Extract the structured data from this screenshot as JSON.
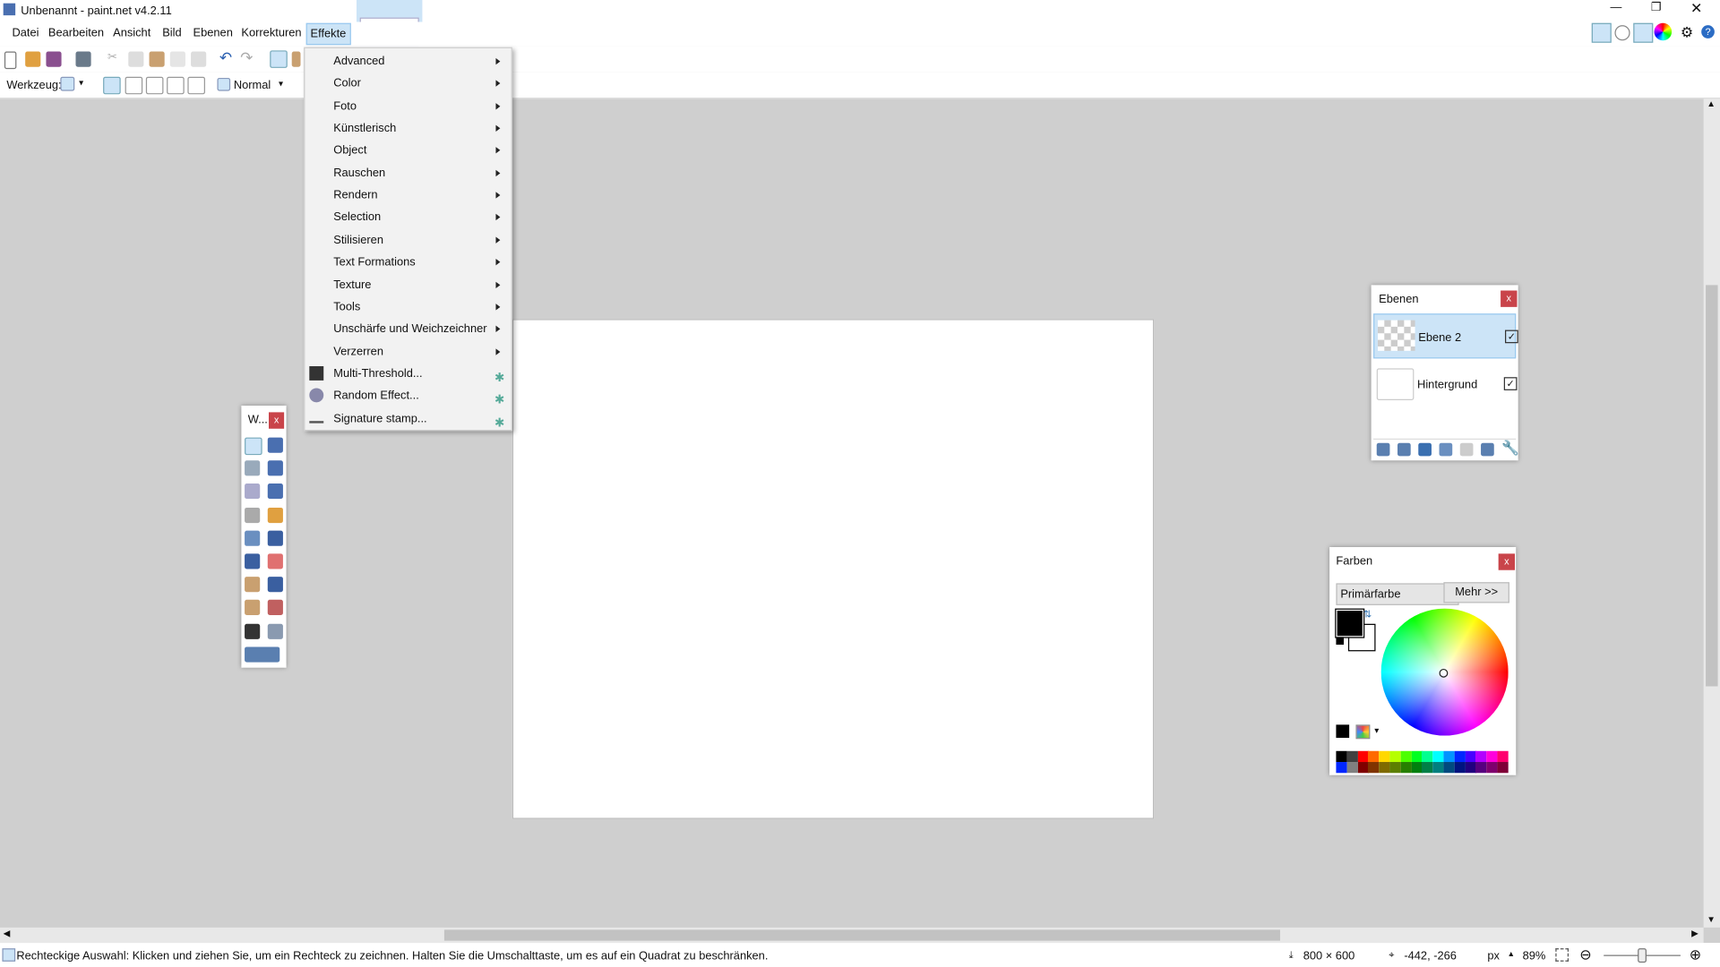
{
  "window": {
    "title": "Unbenannt - paint.net v4.2.11"
  },
  "menubar": [
    "Datei",
    "Bearbeiten",
    "Ansicht",
    "Bild",
    "Ebenen",
    "Korrekturen",
    "Effekte"
  ],
  "toolbar": {
    "tool_label": "Werkzeug:",
    "blend_mode": "Normal"
  },
  "effects_menu": [
    {
      "label": "Advanced",
      "submenu": true
    },
    {
      "label": "Color",
      "submenu": true
    },
    {
      "label": "Foto",
      "submenu": true
    },
    {
      "label": "Künstlerisch",
      "submenu": true
    },
    {
      "label": "Object",
      "submenu": true
    },
    {
      "label": "Rauschen",
      "submenu": true
    },
    {
      "label": "Rendern",
      "submenu": true
    },
    {
      "label": "Selection",
      "submenu": true
    },
    {
      "label": "Stilisieren",
      "submenu": true
    },
    {
      "label": "Text Formations",
      "submenu": true
    },
    {
      "label": "Texture",
      "submenu": true
    },
    {
      "label": "Tools",
      "submenu": true
    },
    {
      "label": "Unschärfe und Weichzeichner",
      "submenu": true
    },
    {
      "label": "Verzerren",
      "submenu": true
    },
    {
      "label": "Multi-Threshold...",
      "plugin": true
    },
    {
      "label": "Random Effect...",
      "plugin": true
    },
    {
      "label": "Signature stamp...",
      "plugin": true
    }
  ],
  "tools_panel": {
    "title": "W...",
    "close": "x"
  },
  "layers_panel": {
    "title": "Ebenen",
    "close": "x",
    "layers": [
      {
        "name": "Ebene 2",
        "visible": true,
        "selected": true
      },
      {
        "name": "Hintergrund",
        "visible": true,
        "selected": false
      }
    ]
  },
  "colors_panel": {
    "title": "Farben",
    "close": "x",
    "mode": "Primärfarbe",
    "more": "Mehr >>",
    "primary": "#000000",
    "secondary": "#ffffff",
    "palette_top": [
      "#000000",
      "#404040",
      "#ff0000",
      "#ff6a00",
      "#ffd800",
      "#b6ff00",
      "#4cff00",
      "#00ff21",
      "#00ff90",
      "#00ffff",
      "#0094ff",
      "#0026ff",
      "#4800ff",
      "#b200ff",
      "#ff00dc",
      "#ff006e"
    ],
    "palette_bottom": [
      "#0026ff",
      "#808080",
      "#7f0000",
      "#7f3300",
      "#7f6a00",
      "#5b7f00",
      "#267f00",
      "#007f0e",
      "#007f46",
      "#007f7f",
      "#004a7f",
      "#00137f",
      "#21007f",
      "#57007f",
      "#7f006e",
      "#7f0037"
    ]
  },
  "status": {
    "hint": "Rechteckige Auswahl: Klicken und ziehen Sie, um ein Rechteck zu zeichnen. Halten Sie die Umschalttaste, um es auf ein Quadrat zu beschränken.",
    "image_size": "800 × 600",
    "cursor_pos": "-442, -266",
    "unit": "px",
    "zoom": "89%"
  }
}
